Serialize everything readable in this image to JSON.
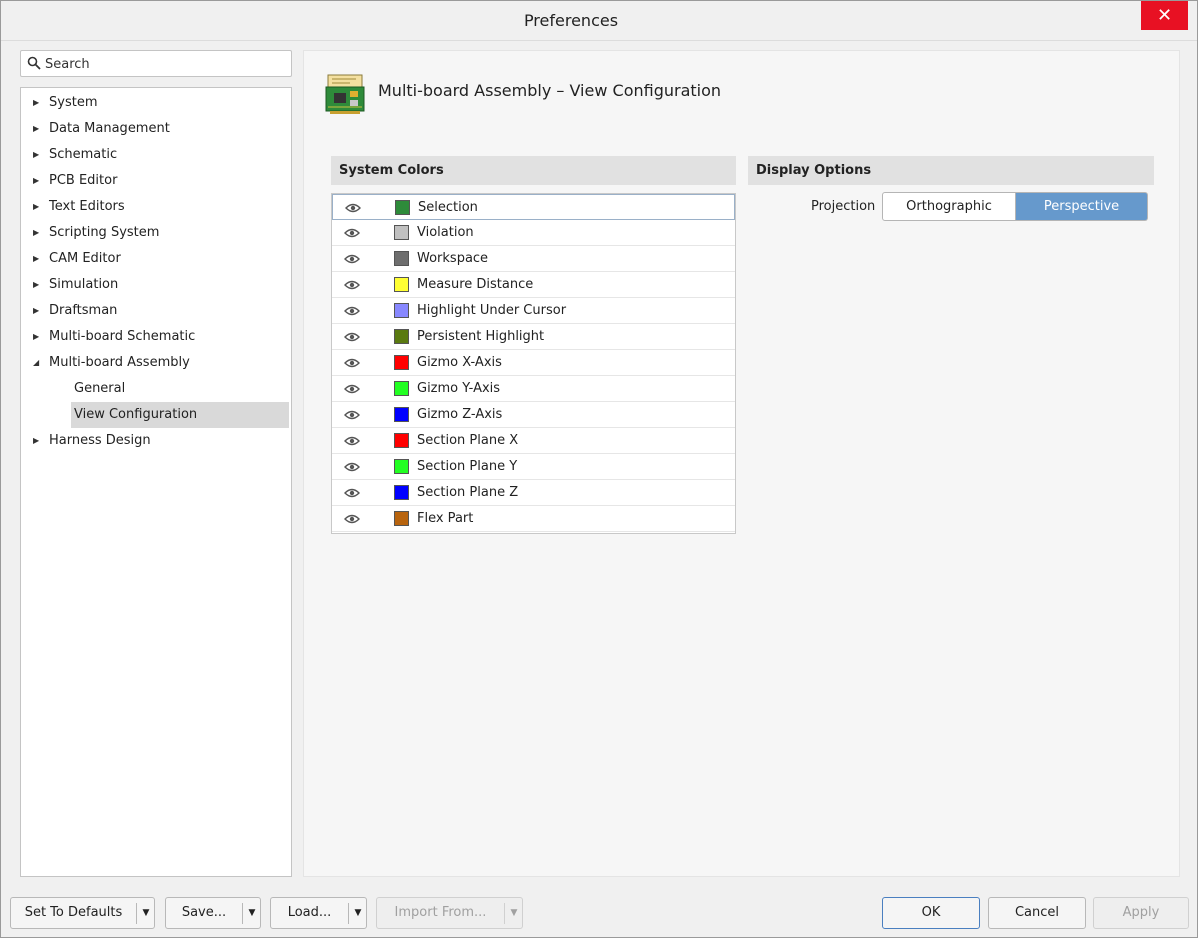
{
  "window": {
    "title": "Preferences",
    "close_glyph": "✕"
  },
  "search": {
    "placeholder": "Search"
  },
  "tree": {
    "items": [
      {
        "label": "System",
        "expanded": false
      },
      {
        "label": "Data Management",
        "expanded": false
      },
      {
        "label": "Schematic",
        "expanded": false
      },
      {
        "label": "PCB Editor",
        "expanded": false
      },
      {
        "label": "Text Editors",
        "expanded": false
      },
      {
        "label": "Scripting System",
        "expanded": false
      },
      {
        "label": "CAM Editor",
        "expanded": false
      },
      {
        "label": "Simulation",
        "expanded": false
      },
      {
        "label": "Draftsman",
        "expanded": false
      },
      {
        "label": "Multi-board Schematic",
        "expanded": false
      },
      {
        "label": "Multi-board Assembly",
        "expanded": true
      },
      {
        "label": "General",
        "child": true
      },
      {
        "label": "View Configuration",
        "child": true,
        "selected": true
      },
      {
        "label": "Harness Design",
        "expanded": false
      }
    ]
  },
  "page": {
    "heading": "Multi-board Assembly – View Configuration"
  },
  "system_colors": {
    "header": "System Colors",
    "rows": [
      {
        "name": "Selection",
        "color": "#2e8b3a"
      },
      {
        "name": "Violation",
        "color": "#c0c0c0"
      },
      {
        "name": "Workspace",
        "color": "#6e6e6e"
      },
      {
        "name": "Measure Distance",
        "color": "#ffff33"
      },
      {
        "name": "Highlight Under Cursor",
        "color": "#8888ff"
      },
      {
        "name": "Persistent Highlight",
        "color": "#5a7a10"
      },
      {
        "name": "Gizmo X-Axis",
        "color": "#ff0000"
      },
      {
        "name": "Gizmo Y-Axis",
        "color": "#22ff22"
      },
      {
        "name": "Gizmo Z-Axis",
        "color": "#0000ff"
      },
      {
        "name": "Section Plane X",
        "color": "#ff0000"
      },
      {
        "name": "Section Plane Y",
        "color": "#22ff22"
      },
      {
        "name": "Section Plane Z",
        "color": "#0000ff"
      },
      {
        "name": "Flex Part",
        "color": "#b8640e"
      }
    ]
  },
  "display_options": {
    "header": "Display Options",
    "projection_label": "Projection",
    "orthographic": "Orthographic",
    "perspective": "Perspective",
    "selected": "Perspective"
  },
  "buttons": {
    "set_to_defaults": "Set To Defaults",
    "save": "Save...",
    "load": "Load...",
    "import_from": "Import From...",
    "ok": "OK",
    "cancel": "Cancel",
    "apply": "Apply"
  }
}
